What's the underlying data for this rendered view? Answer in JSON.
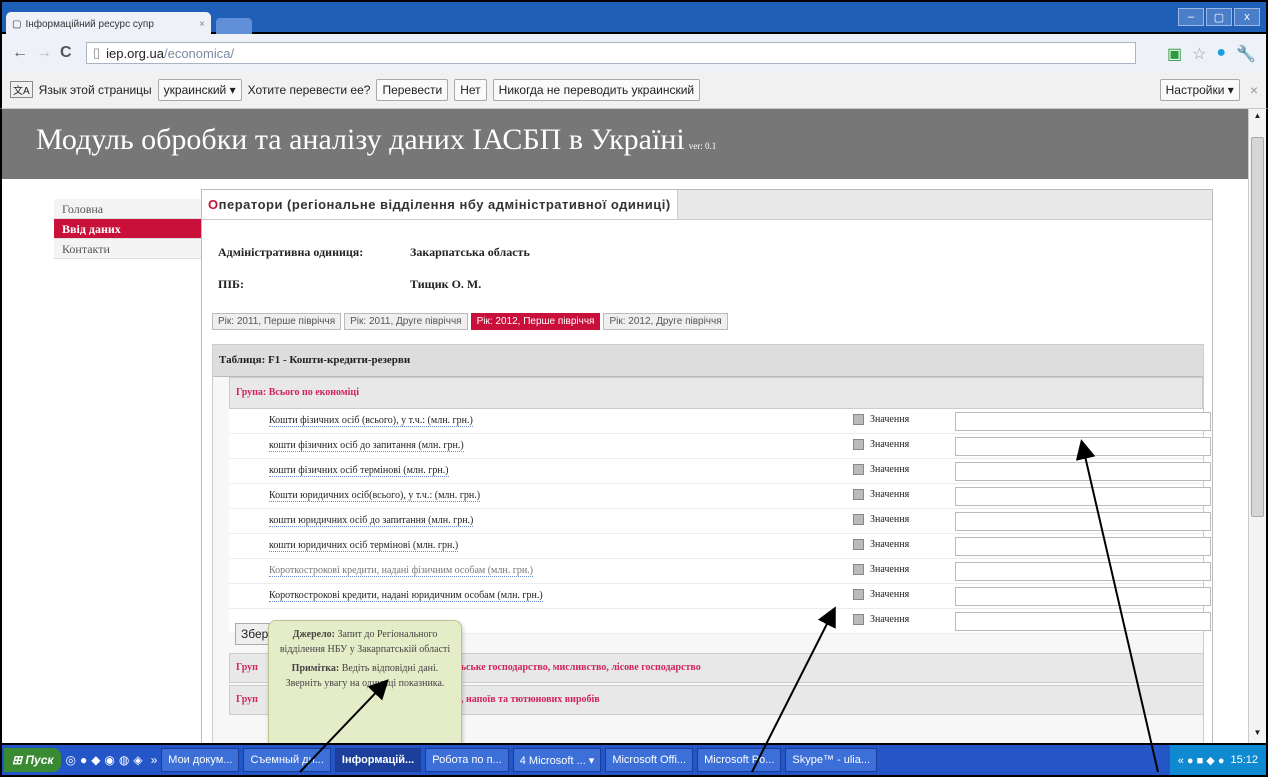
{
  "browser": {
    "tab_title": "Інформаційний ресурс супр",
    "tab_close": "×",
    "url_domain": "iep.org.ua",
    "url_path": "/economica/",
    "win_minimize": "–",
    "win_maximize": "▢",
    "win_close": "x"
  },
  "translate_bar": {
    "prefix": "Язык этой страницы",
    "language": "украинский ▾",
    "question": "Хотите перевести ее?",
    "translate_btn": "Перевести",
    "no_btn": "Нет",
    "never_btn": "Никогда не переводить украинский",
    "settings_btn": "Настройки ▾",
    "close": "×"
  },
  "site": {
    "title": "Модуль обробки та аналізу даних ІАСБП в Україні",
    "version": "ver: 0.1"
  },
  "sidebar": {
    "items": [
      {
        "label": "Головна"
      },
      {
        "label": "Ввід даних"
      },
      {
        "label": "Контакти"
      }
    ]
  },
  "main": {
    "header_first_letter": "О",
    "header_rest": "ператори (регіональне відділення нбу адміністративної одиниці)",
    "admin_unit_label": "Адміністративна одиниця:",
    "admin_unit_value": "Закарпатська область",
    "pib_label": "ПІБ:",
    "pib_value": "Тищик О. М.",
    "periods": [
      "Рік: 2011, Перше півріччя",
      "Рік: 2011, Друге півріччя",
      "Рік: 2012, Перше півріччя",
      "Рік: 2012, Друге півріччя"
    ],
    "table_title": "Таблиця: F1 - Кошти-кредити-резерви",
    "group_title": "Група: Всього по економіці",
    "value_label": "Значення",
    "rows": [
      "Кошти фізичних осіб (всього), у т.ч.: (млн. грн.)",
      "кошти фізичних осіб до запитання (млн. грн.)",
      "кошти фізичних осіб термінові (млн. грн.)",
      "Кошти юридичних осіб(всього), у т.ч.: (млн. грн.)",
      "кошти юридичних осіб до запитання (млн. грн.)",
      "кошти юридичних осіб термінові (млн. грн.)",
      "Короткострокові кредити, надані фізичним особам (млн. грн.)",
      "Короткострокові кредити, надані юридичним особам (млн. грн.)",
      ""
    ],
    "save_btn": "Збере",
    "group2_left": "Груп",
    "group2_right": "сільське господарство, мисливство, лісове господарство",
    "group3_left": "Груп",
    "group3_right": "тів, напоїв та тютюнових виробів"
  },
  "tooltip": {
    "source_label": "Джерело:",
    "source_text": "Запит до Регіонального відділення НБУ у Закарпатській області",
    "note_label": "Примітка:",
    "note_text": "Ведіть відповідні дані. Зверніть увагу на одиниці показника."
  },
  "taskbar": {
    "start": "Пуск",
    "tasks": [
      "Мои докум...",
      "Съемный ди...",
      "Інформацій...",
      "Робота по п...",
      "4 Microsoft ... ▾",
      "Microsoft Offi...",
      "Microsoft Po...",
      "Skype™ - ulia..."
    ],
    "clock": "15:12"
  }
}
